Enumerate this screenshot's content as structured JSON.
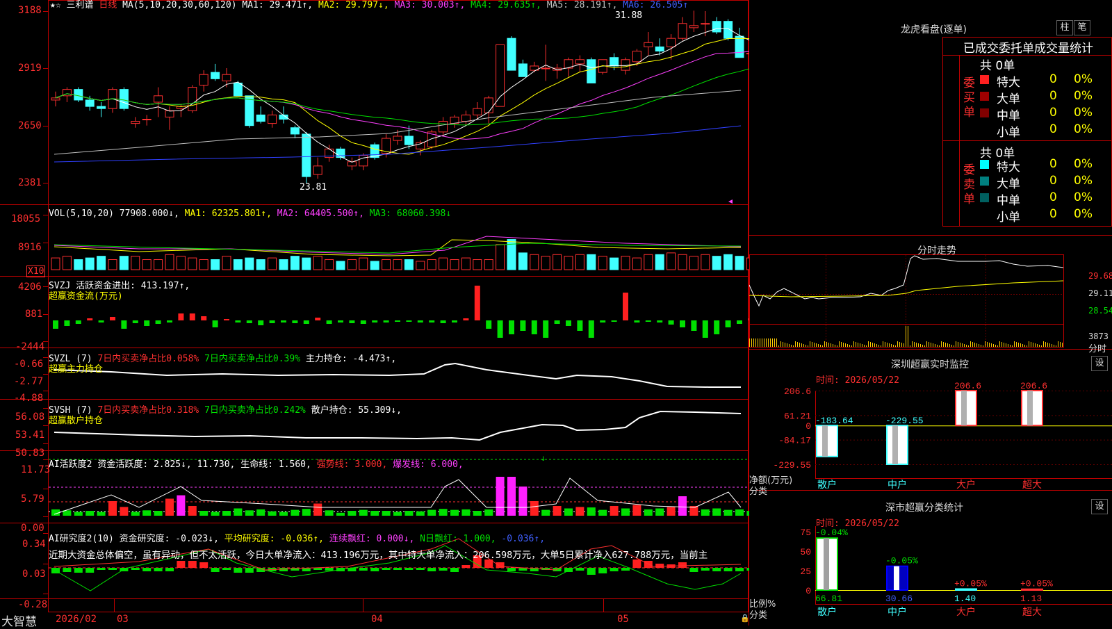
{
  "stock": {
    "name": "三利谱",
    "period": "日线",
    "ma_header": "MA(5,10,20,30,60,120)",
    "ma": [
      {
        "label": "MA1: 29.471↑,",
        "color": "#ffffff"
      },
      {
        "label": "MA2: 29.797↓,",
        "color": "#ffff00"
      },
      {
        "label": "MA3: 30.003↑,",
        "color": "#ff40ff"
      },
      {
        "label": "MA4: 29.635↑,",
        "color": "#00e000"
      },
      {
        "label": "MA5: 28.191↑,",
        "color": "#c0c0c0"
      },
      {
        "label": "MA6: 26.505↑",
        "color": "#4060ff"
      }
    ],
    "price_axis": [
      "3188",
      "2919",
      "2650",
      "2381"
    ],
    "hi_label": "31.88",
    "lo_label": "23.81"
  },
  "vol": {
    "header": "VOL(5,10,20)",
    "value": "77908.000↓,",
    "ma1": "MA1: 62325.801↑,",
    "ma2": "MA2: 64405.500↑,",
    "ma3": "MA3: 68060.398↓",
    "axis": [
      "18055",
      "8916"
    ],
    "unit": "X10"
  },
  "svzj": {
    "header": "SVZJ",
    "line": "活跃资金进出: 413.197↑,",
    "sub": "超赢资金流(万元)",
    "axis": [
      "4206",
      "881",
      "-2444"
    ]
  },
  "svzl": {
    "header": "SVZL (7)",
    "p1": "7日内买卖净占比0.058%",
    "p2": "7日内买卖净占比0.39%",
    "p3": "主力持仓: -4.473↑,",
    "sub": "超赢主力持仓",
    "axis": [
      "-0.66",
      "-2.77",
      "-4.88"
    ]
  },
  "svsh": {
    "header": "SVSH (7)",
    "p1": "7日内买卖净占比0.318%",
    "p2": "7日内买卖净占比0.242%",
    "p3": "散户持仓: 55.309↓,",
    "sub": "超赢散户持仓",
    "axis": [
      "56.08",
      "53.41",
      "50.83"
    ]
  },
  "ai": {
    "header": "AI活跃度2",
    "p1": "资金活跃度: 2.825↓,",
    "p2": "11.730,",
    "p3": "生命线: 1.560,",
    "p4": "强势线: 3.000,",
    "p5": "爆发线: 6.000,",
    "axis": [
      "11.73",
      "5.79",
      "0.00"
    ]
  },
  "air": {
    "header": "AI研究度2(10)",
    "p1": "资金研究度: -0.023↓,",
    "p2": "平均研究度: -0.036↑,",
    "p3": "连续飘红: 0.000↓,",
    "p4": "N日飘红: 1.000,",
    "p5": "-0.036↑,",
    "comment": "近期大资金总体偏空，虽有异动，但不太活跃，今日大单净流入：413.196万元，其中特大单净流入：206.598万元，大单5日累计净入627.788万元，当前主",
    "axis": [
      "0.34",
      "0.03",
      "-0.28"
    ]
  },
  "bottom": {
    "brand": "大智慧",
    "dates": [
      "2026/02",
      "03",
      "04",
      "05"
    ]
  },
  "side": {
    "title": "龙虎看盘(逐单)",
    "btn1": "柱",
    "btn2": "笔",
    "tabs": "已成交委托单成交量统计",
    "buy_label": "委买单",
    "sell_label": "委卖单",
    "buy_total": "共 0单",
    "sell_total": "共 0单",
    "buy_rows": [
      {
        "name": "特大",
        "count": "0",
        "pct": "0%",
        "color": "#ff2020"
      },
      {
        "name": "大单",
        "count": "0",
        "pct": "0%",
        "color": "#a00000"
      },
      {
        "name": "中单",
        "count": "0",
        "pct": "0%",
        "color": "#800000"
      },
      {
        "name": "小单",
        "count": "0",
        "pct": "0%",
        "color": ""
      }
    ],
    "sell_rows": [
      {
        "name": "特大",
        "count": "0",
        "pct": "0%",
        "color": "#00ffff"
      },
      {
        "name": "大单",
        "count": "0",
        "pct": "0%",
        "color": "#008080"
      },
      {
        "name": "中单",
        "count": "0",
        "pct": "0%",
        "color": "#006060"
      },
      {
        "name": "小单",
        "count": "0",
        "pct": "0%",
        "color": ""
      }
    ],
    "intraday_title": "分时走势",
    "intraday_axis": [
      "29.68",
      "29.11",
      "28.54"
    ],
    "intraday_vol": "3873",
    "intraday_vol_label": "分时",
    "monitor_title": "深圳超赢实时监控",
    "monitor_btn": "设",
    "monitor_time": "时间: 2026/05/22",
    "monitor_axis": [
      "206.6",
      "61.21",
      "0",
      "-84.17",
      "-229.55"
    ],
    "monitor_ylabel": "净额(万元)",
    "monitor_xlabel": "分类",
    "stat_title": "深市超赢分类统计",
    "stat_btn": "设",
    "stat_time": "时间: 2026/05/22",
    "stat_axis": [
      "75",
      "50",
      "25",
      "0"
    ],
    "stat_ylabel": "比例%",
    "stat_xlabel": "分类",
    "categories": [
      "散户",
      "中户",
      "大户",
      "超大"
    ]
  },
  "chart_data": [
    {
      "type": "bar",
      "title": "深圳超赢实时监控",
      "categories": [
        "散户",
        "中户",
        "大户",
        "超大"
      ],
      "values": [
        -183.64,
        -229.55,
        206.6,
        206.6
      ],
      "labels": [
        "-183.64",
        "-229.55",
        "206.6",
        "206.6"
      ],
      "ylabel": "净额(万元)",
      "xlabel": "分类",
      "ylim": [
        -229.55,
        206.6
      ]
    },
    {
      "type": "bar",
      "title": "深市超赢分类统计",
      "categories": [
        "散户",
        "中户",
        "大户",
        "超大"
      ],
      "values": [
        66.81,
        30.66,
        1.4,
        1.13
      ],
      "labels": [
        "66.81",
        "30.66",
        "1.40",
        "1.13"
      ],
      "change": [
        "-0.04%",
        "-0.05%",
        "+0.05%",
        "+0.05%"
      ],
      "ylabel": "比例%",
      "xlabel": "分类",
      "ylim": [
        0,
        75
      ]
    }
  ]
}
